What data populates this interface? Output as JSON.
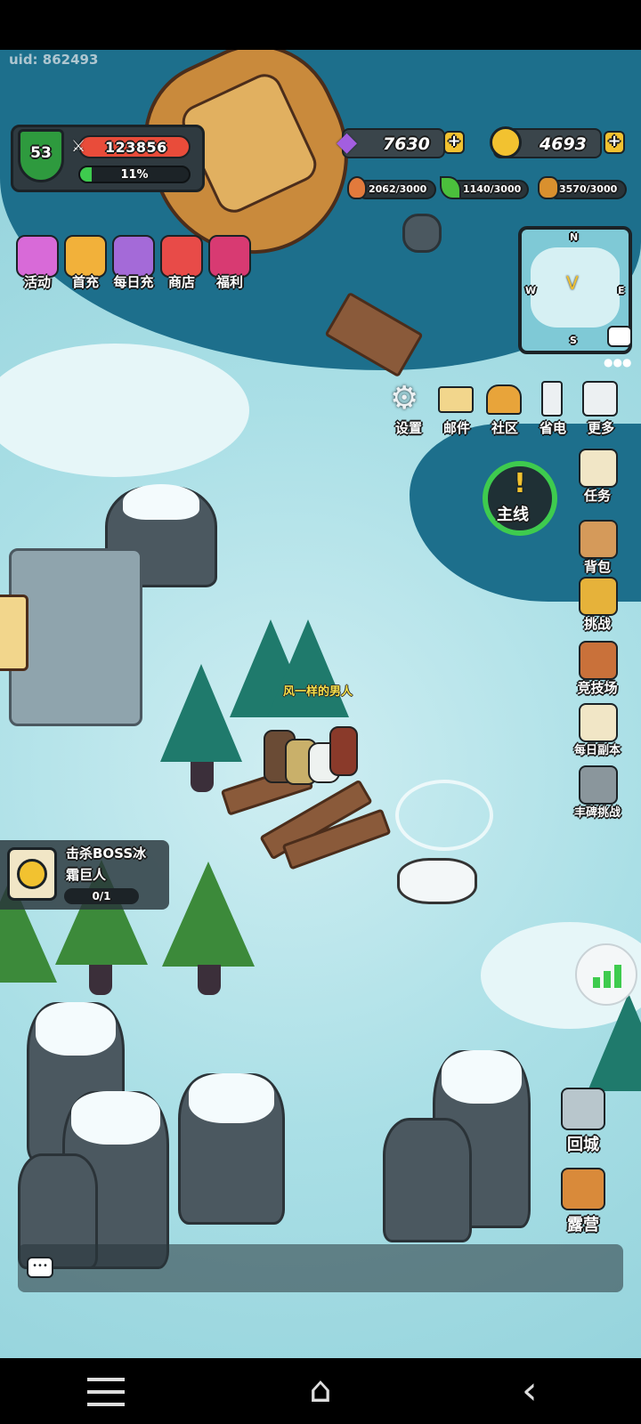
{
  "uid": "uid: 862493",
  "player": {
    "level": "53",
    "power": "123856",
    "exp_text": "11%",
    "exp_fraction": 0.11
  },
  "currency": {
    "gems": "7630",
    "gold": "4693"
  },
  "resources": [
    {
      "icon": "meat-icon",
      "text": "2062/3000"
    },
    {
      "icon": "leaf-icon",
      "text": "1140/3000"
    },
    {
      "icon": "ore-icon",
      "text": "3570/3000"
    }
  ],
  "top_menu": [
    {
      "label": "活动",
      "icon": "event-chest-icon",
      "color": "#d86ad8"
    },
    {
      "label": "首充",
      "icon": "crown-king-icon",
      "color": "#f2b13a"
    },
    {
      "label": "每日充",
      "icon": "treasure-crate-icon",
      "color": "#a46ad8"
    },
    {
      "label": "商店",
      "icon": "shop-stall-icon",
      "color": "#e84b48"
    },
    {
      "label": "福利",
      "icon": "gift-box-icon",
      "color": "#d83a72"
    }
  ],
  "minimap": {
    "north": "N",
    "south": "S",
    "west": "W",
    "east": "E"
  },
  "settings_row": [
    {
      "label": "设置",
      "icon": "gear-icon"
    },
    {
      "label": "邮件",
      "icon": "mail-icon"
    },
    {
      "label": "社区",
      "icon": "house-icon"
    },
    {
      "label": "省电",
      "icon": "battery-icon"
    },
    {
      "label": "更多",
      "icon": "grid-icon"
    }
  ],
  "main_quest": {
    "label": "主线",
    "mark": "!"
  },
  "side_menu": [
    {
      "label": "任务",
      "icon": "scroll-icon"
    },
    {
      "label": "背包",
      "icon": "backpack-icon"
    },
    {
      "label": "挑战",
      "icon": "helmet-icon"
    },
    {
      "label": "竞技场",
      "icon": "arena-icon"
    },
    {
      "label": "每日副本",
      "icon": "map-scroll-icon"
    },
    {
      "label": "丰碑挑战",
      "icon": "monument-icon"
    }
  ],
  "character_name": "风一样的男人",
  "quest": {
    "line1": "击杀BOSS冰",
    "line2": "霜巨人",
    "progress": "0/1"
  },
  "bottom_right": [
    {
      "label": "回城",
      "icon": "portal-gate-icon"
    },
    {
      "label": "露营",
      "icon": "campfire-tent-icon"
    }
  ],
  "colors": {
    "accent": "#3ecb4e",
    "ocean": "#1d6f8c",
    "snow": "#e6f6f8"
  }
}
